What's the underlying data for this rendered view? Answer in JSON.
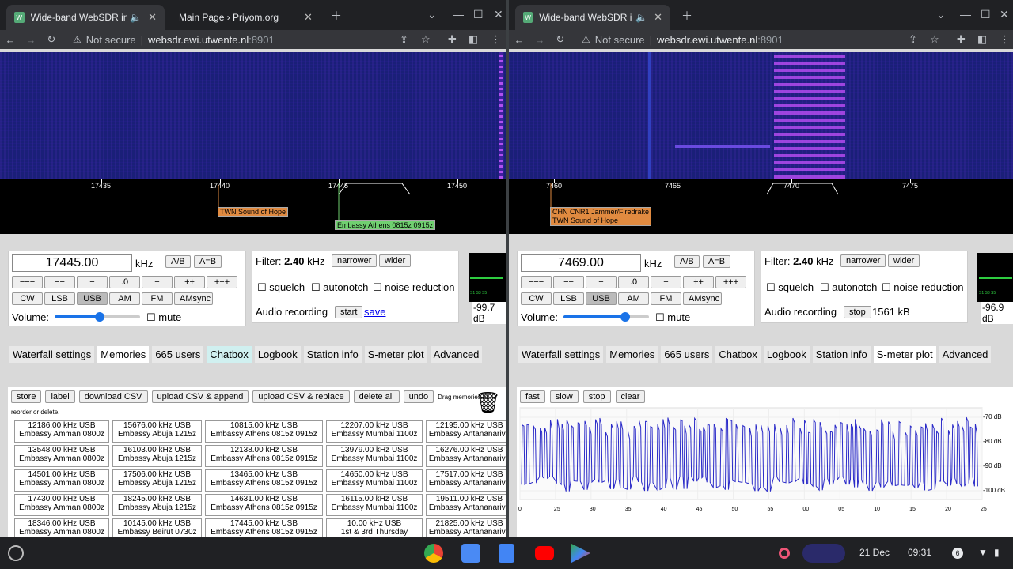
{
  "left": {
    "tabs": [
      {
        "title": "Wide-band WebSDR in Ensch",
        "active": true
      },
      {
        "title": "Main Page › Priyom.org",
        "active": false
      }
    ],
    "address": {
      "not_secure": "Not secure",
      "host": "websdr.ewi.utwente.nl",
      "port": ":8901"
    },
    "scale_ticks": [
      "17435",
      "17440",
      "17445",
      "17450"
    ],
    "station_labels": [
      "TWN Sound of Hope",
      "Embassy Athens 0815z 0915z"
    ],
    "frequency": "17445.00",
    "khz": "kHz",
    "ab": "A/B",
    "aeqb": "A=B",
    "step_buttons": [
      "−−−",
      "−−",
      "−",
      ".0",
      "+",
      "++",
      "+++"
    ],
    "modes": [
      "CW",
      "LSB",
      "USB",
      "AM",
      "FM",
      "AMsync"
    ],
    "selected_mode": "USB",
    "volume_label": "Volume:",
    "mute_label": "mute",
    "filter_label": "Filter:",
    "filter_value": "2.40",
    "filter_unit": "kHz",
    "narrower": "narrower",
    "wider": "wider",
    "checks": [
      "squelch",
      "autonotch",
      "noise reduction"
    ],
    "audio_label": "Audio recording",
    "audio_btn": "start",
    "audio_link": "save",
    "smeter_reading": "-99.7 dB",
    "panel_tabs": [
      "Waterfall settings",
      "Memories",
      "665 users",
      "Chatbox",
      "Logbook",
      "Station info",
      "S-meter plot",
      "Advanced"
    ],
    "active_panel_tab": "Memories",
    "mem_buttons": [
      "store",
      "label",
      "download CSV",
      "upload CSV & append",
      "upload CSV & replace",
      "delete all",
      "undo"
    ],
    "mem_hint_a": "Drag memories to",
    "mem_hint_b": "reorder or delete.",
    "memories": [
      [
        "12186.00 kHz USB",
        "Embassy Amman 0800z",
        "15676.00 kHz USB",
        "Embassy Abuja 1215z",
        "10815.00 kHz USB",
        "Embassy Athens 0815z 0915z",
        "12207.00 kHz USB",
        "Embassy Mumbai 1100z",
        "12195.00 kHz USB",
        "Embassy Antananarivo"
      ],
      [
        "13548.00 kHz USB",
        "Embassy Amman 0800z",
        "16103.00 kHz USB",
        "Embassy Abuja 1215z",
        "12138.00 kHz USB",
        "Embassy Athens 0815z 0915z",
        "13979.00 kHz USB",
        "Embassy Mumbai 1100z",
        "16276.00 kHz USB",
        "Embassy Antananarivo"
      ],
      [
        "14501.00 kHz USB",
        "Embassy Amman 0800z",
        "17506.00 kHz USB",
        "Embassy Abuja 1215z",
        "13465.00 kHz USB",
        "Embassy Athens 0815z 0915z",
        "14650.00 kHz USB",
        "Embassy Mumbai 1100z",
        "17517.00 kHz USB",
        "Embassy Antananarivo"
      ],
      [
        "17430.00 kHz USB",
        "Embassy Amman 0800z",
        "18245.00 kHz USB",
        "Embassy Abuja 1215z",
        "14631.00 kHz USB",
        "Embassy Athens 0815z 0915z",
        "16115.00 kHz USB",
        "Embassy Mumbai 1100z",
        "19511.00 kHz USB",
        "Embassy Antananarivo"
      ],
      [
        "18346.00 kHz USB",
        "Embassy Amman 0800z",
        "10145.00 kHz USB",
        "Embassy Beirut 0730z",
        "17445.00 kHz USB",
        "Embassy Athens 0815z 0915z",
        "10.00 kHz USB",
        "1st & 3rd Thursday",
        "21825.00 kHz USB",
        "Embassy Antananarivo"
      ]
    ]
  },
  "right": {
    "tabs": [
      {
        "title": "Wide-band WebSDR in Ensch",
        "active": true
      }
    ],
    "address": {
      "not_secure": "Not secure",
      "host": "websdr.ewi.utwente.nl",
      "port": ":8901"
    },
    "scale_ticks": [
      "7460",
      "7465",
      "7470",
      "7475"
    ],
    "station_labels": [
      "CHN CNR1 Jammer/Firedrake",
      "TWN Sound of Hope"
    ],
    "frequency": "7469.00",
    "khz": "kHz",
    "ab": "A/B",
    "aeqb": "A=B",
    "step_buttons": [
      "−−−",
      "−−",
      "−",
      ".0",
      "+",
      "++",
      "+++"
    ],
    "modes": [
      "CW",
      "LSB",
      "USB",
      "AM",
      "FM",
      "AMsync"
    ],
    "selected_mode": "USB",
    "volume_label": "Volume:",
    "mute_label": "mute",
    "filter_label": "Filter:",
    "filter_value": "2.40",
    "filter_unit": "kHz",
    "narrower": "narrower",
    "wider": "wider",
    "checks": [
      "squelch",
      "autonotch",
      "noise reduction"
    ],
    "audio_label": "Audio recording",
    "audio_btn": "stop",
    "audio_size": "1561 kB",
    "smeter_reading": "-96.9 dB",
    "panel_tabs": [
      "Waterfall settings",
      "Memories",
      "665 users",
      "Chatbox",
      "Logbook",
      "Station info",
      "S-meter plot",
      "Advanced"
    ],
    "active_panel_tab": "S-meter plot",
    "plot_buttons": [
      "fast",
      "slow",
      "stop",
      "clear"
    ],
    "plot_ylabels": [
      "-70 dB",
      "-80 dB",
      "-90 dB",
      "-100 dB"
    ],
    "plot_xlabels": [
      "0",
      "25",
      "30",
      "35",
      "40",
      "45",
      "50",
      "55",
      "00",
      "05",
      "10",
      "15",
      "20",
      "25"
    ]
  },
  "taskbar": {
    "date": "21 Dec",
    "time": "09:31",
    "badge": "6",
    "apps": [
      "chrome-icon",
      "files-icon",
      "docs-icon",
      "youtube-icon",
      "play-store-icon"
    ]
  },
  "colors": {
    "accent_orange": "#e08a40",
    "accent_green": "#70d070",
    "waterfall_bg": "#1a1f78",
    "plot_line": "#2a2ac8"
  }
}
